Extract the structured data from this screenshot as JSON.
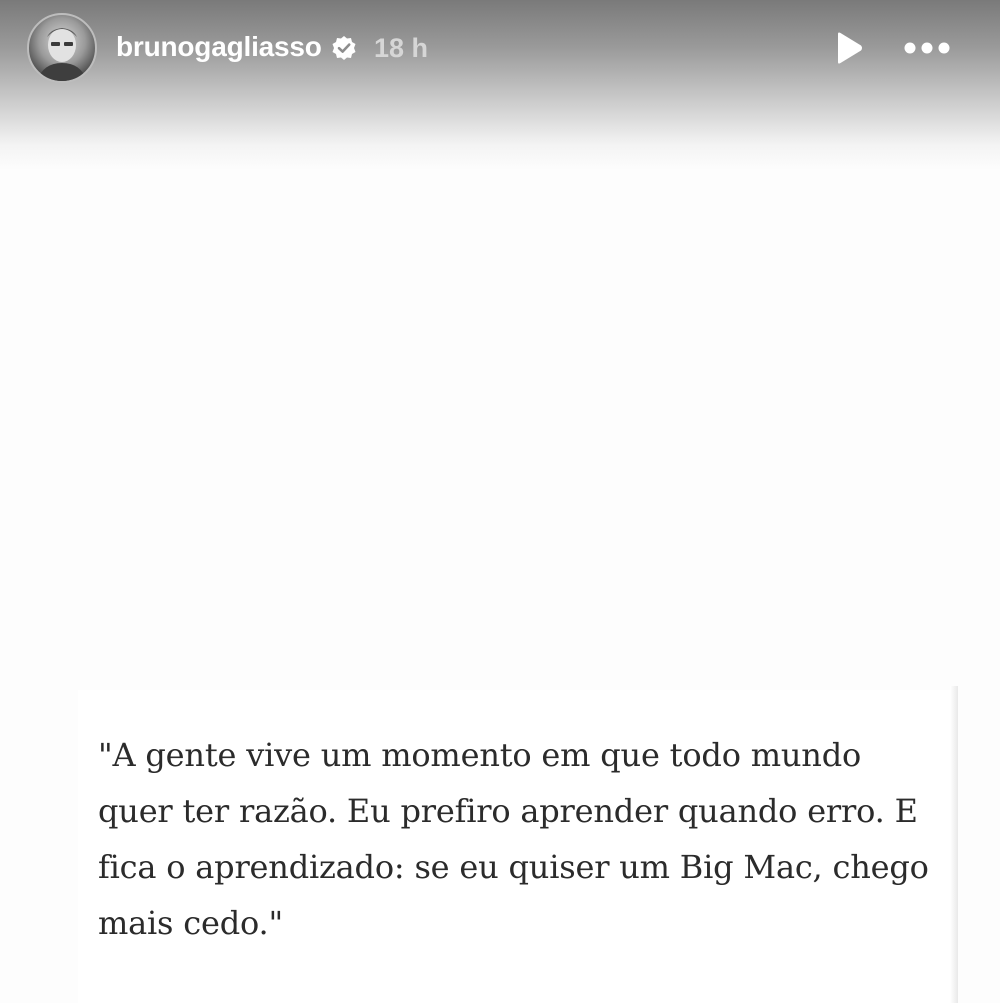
{
  "header": {
    "username": "brunogagliasso",
    "time_ago": "18 h",
    "verified": true,
    "icons": {
      "avatar": "profile-photo",
      "verified": "verified-badge-icon",
      "play": "play-icon",
      "more": "more-options-icon"
    }
  },
  "post": {
    "quote": "\"A gente vive um momento em que todo mundo quer ter razão. Eu prefiro aprender quando erro. E fica o aprendizado: se eu quiser um Big Mac, chego mais cedo.\""
  },
  "colors": {
    "header_gradient_top": "#7a7a7a",
    "background": "#fdfdfd",
    "text": "#2b2b2b",
    "username": "#ffffff",
    "time": "#d6d6d6"
  }
}
